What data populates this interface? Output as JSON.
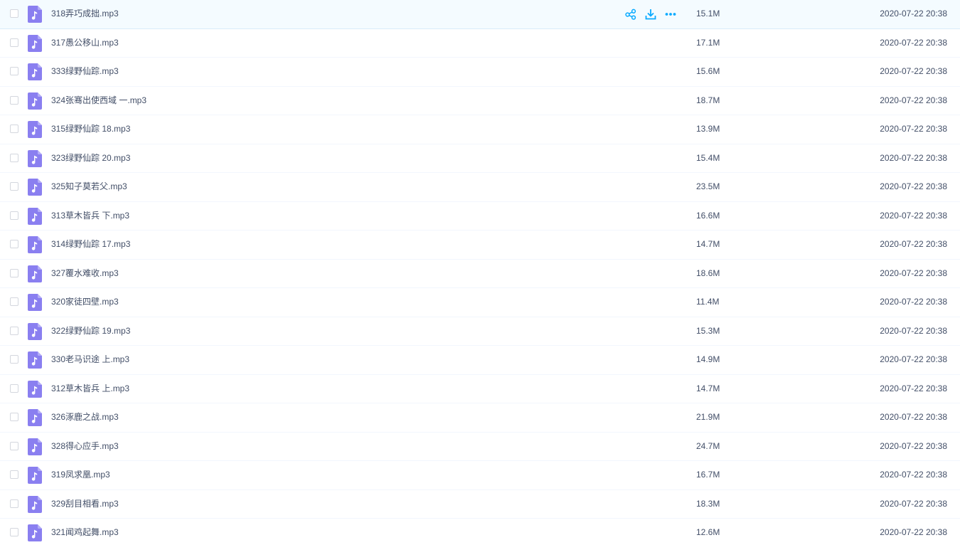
{
  "colors": {
    "accent": "#09aaff",
    "icon_purple": "#8a7ff0",
    "text": "#424e67",
    "hover_row": "#f4fbff"
  },
  "row_actions": {
    "share_icon": "share-icon",
    "download_icon": "download-icon",
    "more_icon": "more-icon"
  },
  "files": [
    {
      "name": "318弄巧成拙.mp3",
      "size": "15.1M",
      "time": "2020-07-22 20:38"
    },
    {
      "name": "317愚公移山.mp3",
      "size": "17.1M",
      "time": "2020-07-22 20:38"
    },
    {
      "name": "333绿野仙踪.mp3",
      "size": "15.6M",
      "time": "2020-07-22 20:38"
    },
    {
      "name": "324张骞出使西域 一.mp3",
      "size": "18.7M",
      "time": "2020-07-22 20:38"
    },
    {
      "name": "315绿野仙踪 18.mp3",
      "size": "13.9M",
      "time": "2020-07-22 20:38"
    },
    {
      "name": "323绿野仙踪 20.mp3",
      "size": "15.4M",
      "time": "2020-07-22 20:38"
    },
    {
      "name": "325知子莫若父.mp3",
      "size": "23.5M",
      "time": "2020-07-22 20:38"
    },
    {
      "name": "313草木皆兵 下.mp3",
      "size": "16.6M",
      "time": "2020-07-22 20:38"
    },
    {
      "name": "314绿野仙踪 17.mp3",
      "size": "14.7M",
      "time": "2020-07-22 20:38"
    },
    {
      "name": "327覆水难收.mp3",
      "size": "18.6M",
      "time": "2020-07-22 20:38"
    },
    {
      "name": "320家徒四壁.mp3",
      "size": "11.4M",
      "time": "2020-07-22 20:38"
    },
    {
      "name": "322绿野仙踪 19.mp3",
      "size": "15.3M",
      "time": "2020-07-22 20:38"
    },
    {
      "name": "330老马识途 上.mp3",
      "size": "14.9M",
      "time": "2020-07-22 20:38"
    },
    {
      "name": "312草木皆兵 上.mp3",
      "size": "14.7M",
      "time": "2020-07-22 20:38"
    },
    {
      "name": "326涿鹿之战.mp3",
      "size": "21.9M",
      "time": "2020-07-22 20:38"
    },
    {
      "name": "328得心应手.mp3",
      "size": "24.7M",
      "time": "2020-07-22 20:38"
    },
    {
      "name": "319凤求凰.mp3",
      "size": "16.7M",
      "time": "2020-07-22 20:38"
    },
    {
      "name": "329刮目相看.mp3",
      "size": "18.3M",
      "time": "2020-07-22 20:38"
    },
    {
      "name": "321闻鸡起舞.mp3",
      "size": "12.6M",
      "time": "2020-07-22 20:38"
    }
  ]
}
